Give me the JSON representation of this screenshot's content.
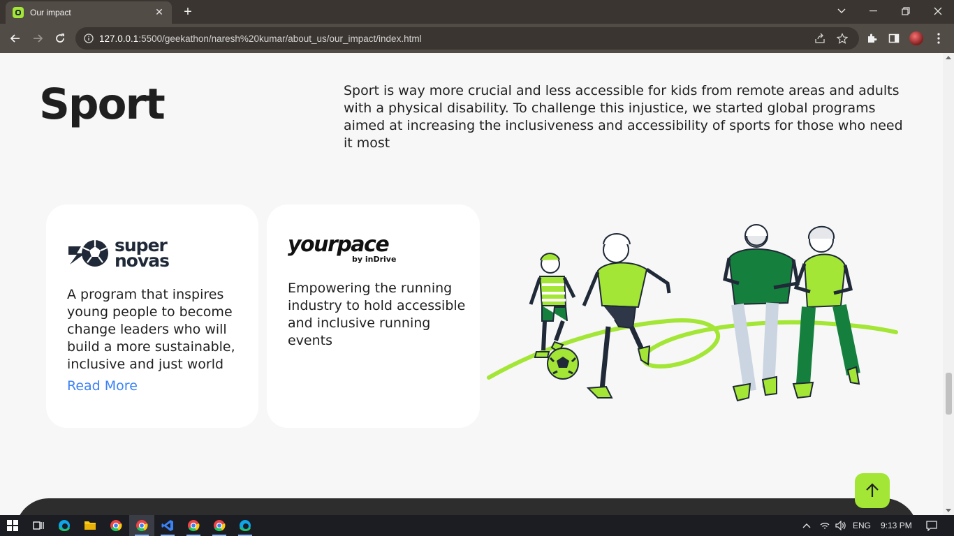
{
  "browser": {
    "tab_title": "Our impact",
    "tab_close": "✕",
    "new_tab": "+",
    "url_host": "127.0.0.1",
    "url_rest": ":5500/geekathon/naresh%20kumar/about_us/our_impact/index.html"
  },
  "section": {
    "title": "Sport",
    "description": "Sport is way more crucial and less accessible for kids from remote areas and adults with a physical disability. To challenge this injustice, we started global programs aimed at increasing the inclusiveness and accessibility of sports for those who need it most"
  },
  "cards": [
    {
      "logo_line1": "super",
      "logo_line2": "novas",
      "text": "A program that inspires young people to become change leaders who will build a more sustainable, inclusive and just world",
      "link": "Read More"
    },
    {
      "logo_main": "yourpace",
      "logo_sub": "by inDrive",
      "text": "Empowering the running industry to hold accessible and inclusive running events"
    }
  ],
  "taskbar": {
    "lang": "ENG",
    "time": "9:13 PM"
  },
  "colors": {
    "accent": "#a3e635",
    "dark_green": "#15803d",
    "link": "#3b82f6",
    "text": "#1f1f1f"
  }
}
